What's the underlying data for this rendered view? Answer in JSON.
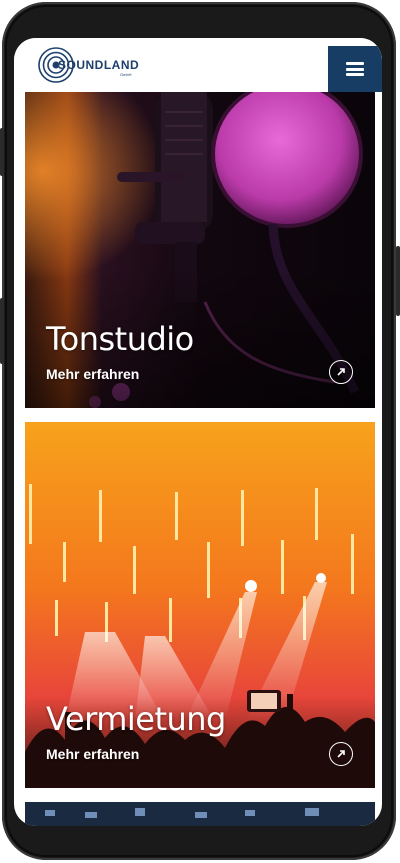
{
  "header": {
    "logo_text": "SOUNDLAND",
    "logo_sub": "GmbH",
    "menu_icon": "hamburger-icon"
  },
  "cards": [
    {
      "title": "Tonstudio",
      "link": "Mehr erfahren",
      "icon": "arrow-up-right-icon"
    },
    {
      "title": "Vermietung",
      "link": "Mehr erfahren",
      "icon": "arrow-up-right-icon"
    }
  ],
  "colors": {
    "brand": "#173d64",
    "card1_accent": "#c43cb2",
    "card2_accent": "#f5821f"
  }
}
